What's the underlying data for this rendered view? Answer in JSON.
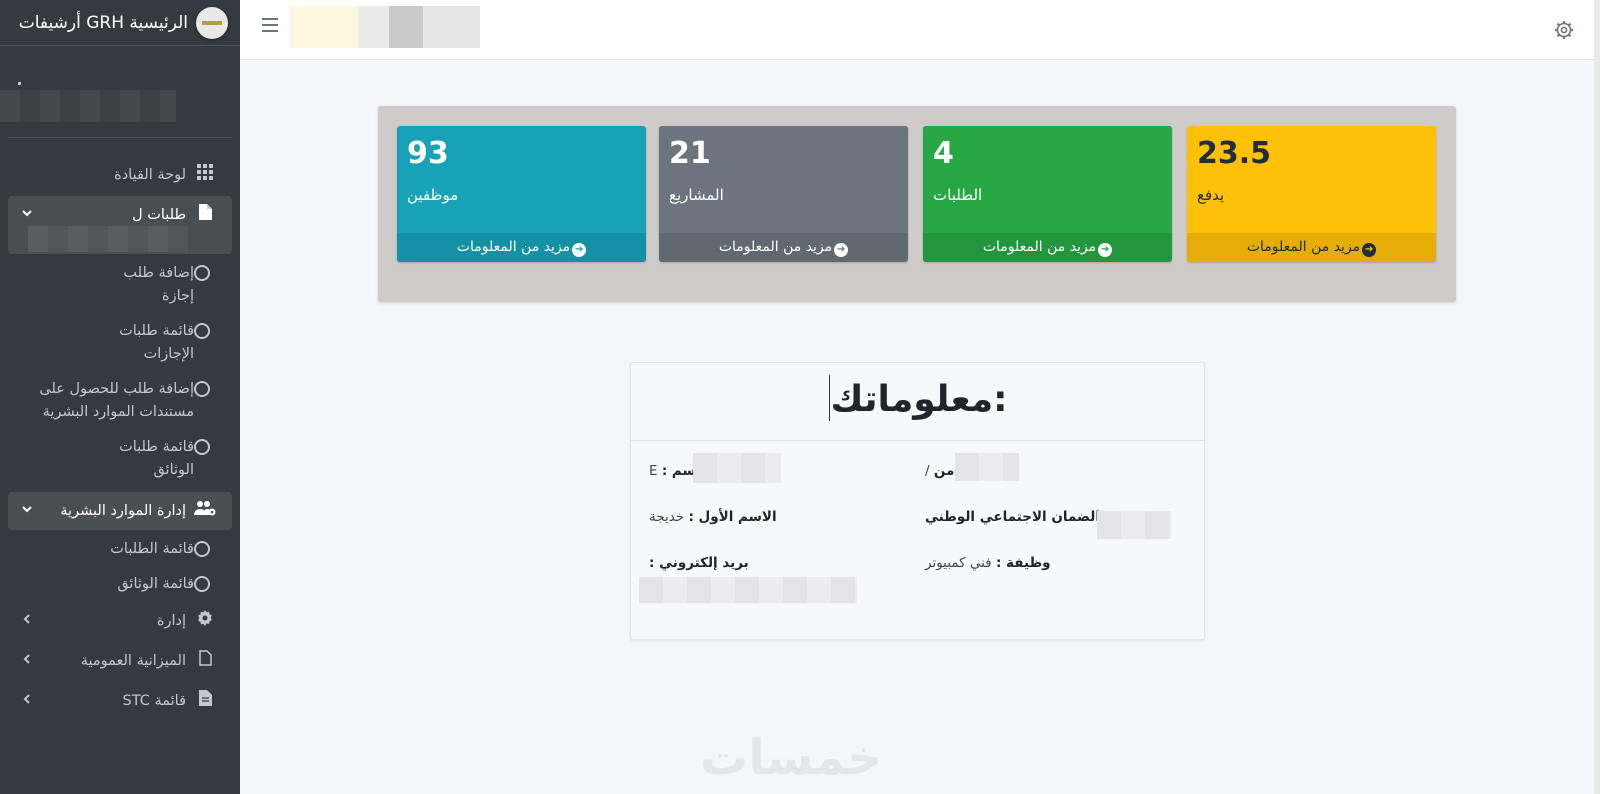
{
  "brand": {
    "title": "الرئيسية GRH أرشيفات"
  },
  "sidebar": {
    "items": [
      {
        "label": "لوحة القيادة",
        "icon": "grid-icon"
      },
      {
        "label": "طلبات ل",
        "icon": "file-icon"
      },
      {
        "label": "إضافة طلب إجازة"
      },
      {
        "label": "قائمة طلبات الإجازات"
      },
      {
        "label": "إضافة طلب للحصول على مستندات الموارد البشرية"
      },
      {
        "label": "قائمة طلبات الوثائق"
      },
      {
        "label": "إدارة الموارد البشرية",
        "icon": "users-cog-icon"
      },
      {
        "label": "قائمة الطلبات"
      },
      {
        "label": "قائمة الوثائق"
      },
      {
        "label": "إدارة",
        "icon": "gear-icon"
      },
      {
        "label": "الميزانية العمومية",
        "icon": "file-icon"
      },
      {
        "label": "قائمة STC",
        "icon": "file-icon"
      }
    ]
  },
  "stats": [
    {
      "value": "23.5",
      "label": "يدفع",
      "more": "مزيد من المعلومات",
      "color": "#ffc107"
    },
    {
      "value": "4",
      "label": "الطلبات",
      "more": "مزيد من المعلومات",
      "color": "#28a745"
    },
    {
      "value": "21",
      "label": "المشاريع",
      "more": "مزيد من المعلومات",
      "color": "#6c757d"
    },
    {
      "value": "93",
      "label": "موظفين",
      "more": "مزيد من المعلومات",
      "color": "#17a2b8"
    }
  ],
  "card": {
    "title": ":معلوماتك",
    "fields": {
      "from": {
        "label": ":من",
        "value": "/"
      },
      "name": {
        "label": "اسم :",
        "value": "E"
      },
      "cnss": {
        "label": ":الضمان الاجتماعي الوطني",
        "value": ""
      },
      "first_name": {
        "label": "الاسم الأول :",
        "value": "خديجة"
      },
      "job": {
        "label": "وظيفة :",
        "value": "فني كمبيوتر"
      },
      "email": {
        "label": "بريد إلكتروني :",
        "value": ""
      }
    }
  },
  "watermark": "خمسات"
}
